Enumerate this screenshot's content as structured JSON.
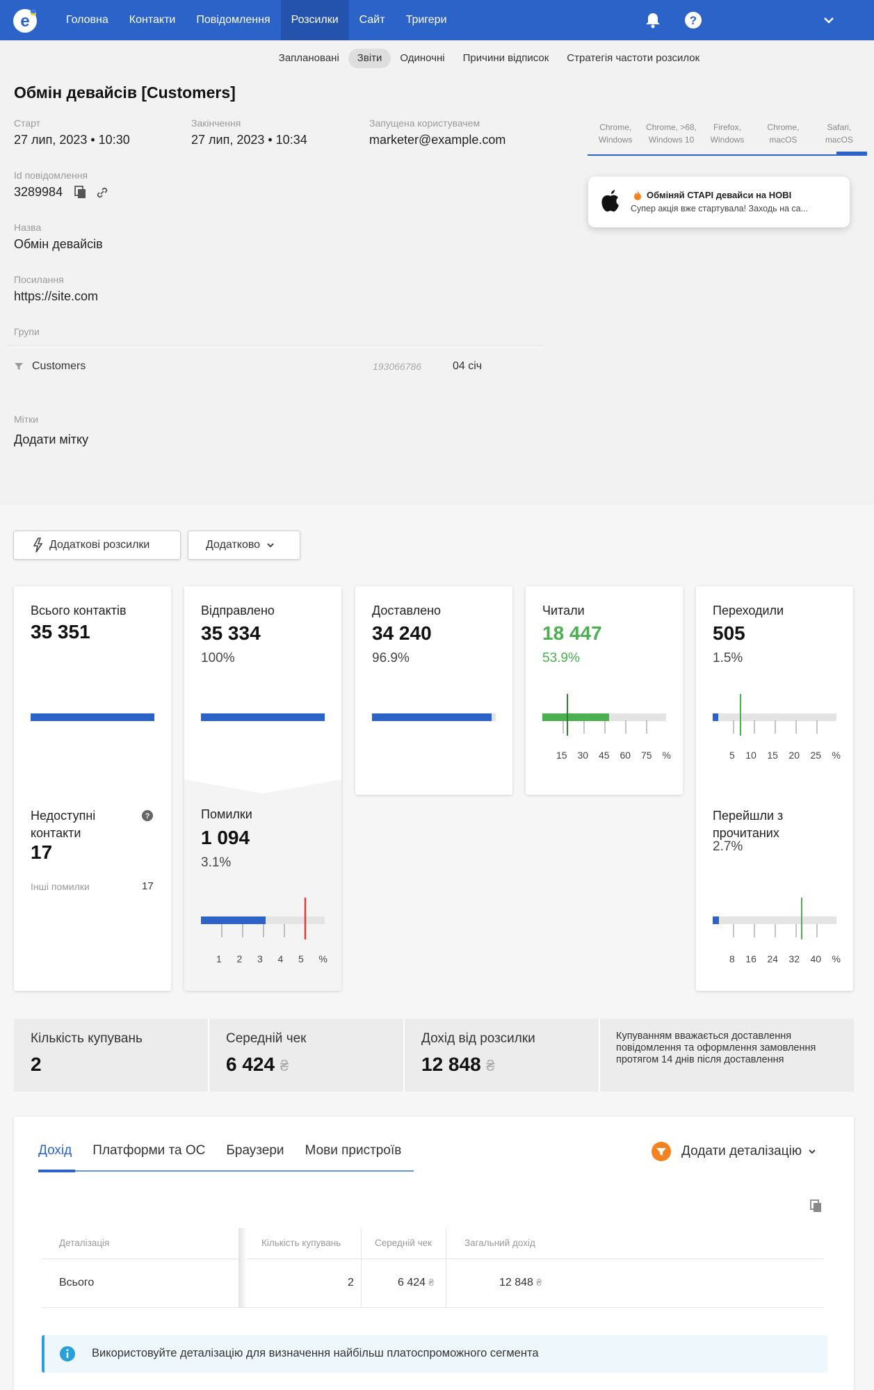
{
  "nav": {
    "items": [
      "Головна",
      "Контакти",
      "Повідомлення",
      "Розсилки",
      "Сайт",
      "Тригери"
    ],
    "active_index": 3
  },
  "subnav": {
    "items": [
      "Заплановані",
      "Звіти",
      "Одиночні",
      "Причини відписок",
      "Стратегія частоти розсилок"
    ],
    "active_index": 1
  },
  "campaign": {
    "title": "Обмін девайсів [Customers]",
    "start_label": "Старт",
    "start_value": "27 лип, 2023 • 10:30",
    "end_label": "Закінчення",
    "end_value": "27 лип, 2023 • 10:34",
    "launched_label": "Запущена користувачем",
    "launched_value": "marketer@example.com",
    "msgid_label": "Id повідомлення",
    "msgid_value": "3289984",
    "name_label": "Назва",
    "name_value": "Обмін девайсів",
    "link_label": "Посилання",
    "link_value": "https://site.com",
    "groups_label": "Групи",
    "group_name": "Customers",
    "group_id": "193066786",
    "group_date": "04 січ",
    "tags_label": "Мітки",
    "tags_add": "Додати мітку"
  },
  "preview": {
    "tabs": [
      [
        "Chrome,",
        "Windows"
      ],
      [
        "Chrome, >68,",
        "Windows 10"
      ],
      [
        "Firefox,",
        "Windows"
      ],
      [
        "Chrome,",
        "macOS"
      ],
      [
        "Safari,",
        "macOS"
      ]
    ],
    "active_index": 4,
    "push_title": "Обміняй СТАРІ девайси на НОВІ",
    "push_body": "Супер акція вже стартувала! Заходь на са..."
  },
  "actions": {
    "extra_button": "Додаткові розсилки",
    "more_button": "Додатково"
  },
  "stats": {
    "total": {
      "label": "Всього контактів",
      "value": "35 351",
      "fill": 1.0
    },
    "sent": {
      "label": "Відправлено",
      "value": "35 334",
      "pct": "100%",
      "fill": 1.0
    },
    "delivered": {
      "label": "Доставлено",
      "value": "34 240",
      "pct": "96.9%",
      "fill": 0.969
    },
    "read": {
      "label": "Читали",
      "value": "18 447",
      "pct": "53.9%",
      "fill": 0.539,
      "marker": 0.2,
      "ticks": [
        "15",
        "30",
        "45",
        "60",
        "75",
        "%"
      ]
    },
    "clicks": {
      "label": "Переходили",
      "value": "505",
      "pct": "1.5%",
      "fill": 0.015,
      "marker": 0.2,
      "ticks": [
        "5",
        "10",
        "15",
        "20",
        "25",
        "%"
      ]
    },
    "unavailable": {
      "label": "Недоступні контакти",
      "value": "17",
      "other_label": "Інші помилки",
      "other_value": "17"
    },
    "errors": {
      "label": "Помилки",
      "value": "1 094",
      "pct": "3.1%",
      "fill": 0.52,
      "marker": 0.83,
      "ticks": [
        "1",
        "2",
        "3",
        "4",
        "5",
        "%"
      ]
    },
    "ctor": {
      "label": "Перейшли з прочитаних",
      "pct": "2.7%",
      "fill": 0.05,
      "marker": 0.72,
      "ticks": [
        "8",
        "16",
        "24",
        "32",
        "40",
        "%"
      ]
    }
  },
  "colors": {
    "blue": "#2b63c9",
    "green": "#4caf50",
    "red": "#e53935"
  },
  "purchases": {
    "count_label": "Кількість купувань",
    "count_value": "2",
    "avg_label": "Середній чек",
    "avg_value": "6 424",
    "revenue_label": "Дохід від розсилки",
    "revenue_value": "12 848",
    "currency": "₴",
    "note": "Купуванням вважається доставлення повідомлення та оформлення замовлення протягом 14 днів після доставлення"
  },
  "detail": {
    "tabs": [
      "Дохід",
      "Платформи та ОС",
      "Браузери",
      "Мови пристроїв"
    ],
    "active_index": 0,
    "add_detail": "Додати деталізацію",
    "headers": [
      "Деталізація",
      "Кількість купувань",
      "Середній чек",
      "Загальний дохід"
    ],
    "row": {
      "name": "Всього",
      "count": "2",
      "avg": "6 424",
      "total": "12 848"
    },
    "info": "Використовуйте деталізацію для визначення найбільш платоспроможного сегмента"
  }
}
